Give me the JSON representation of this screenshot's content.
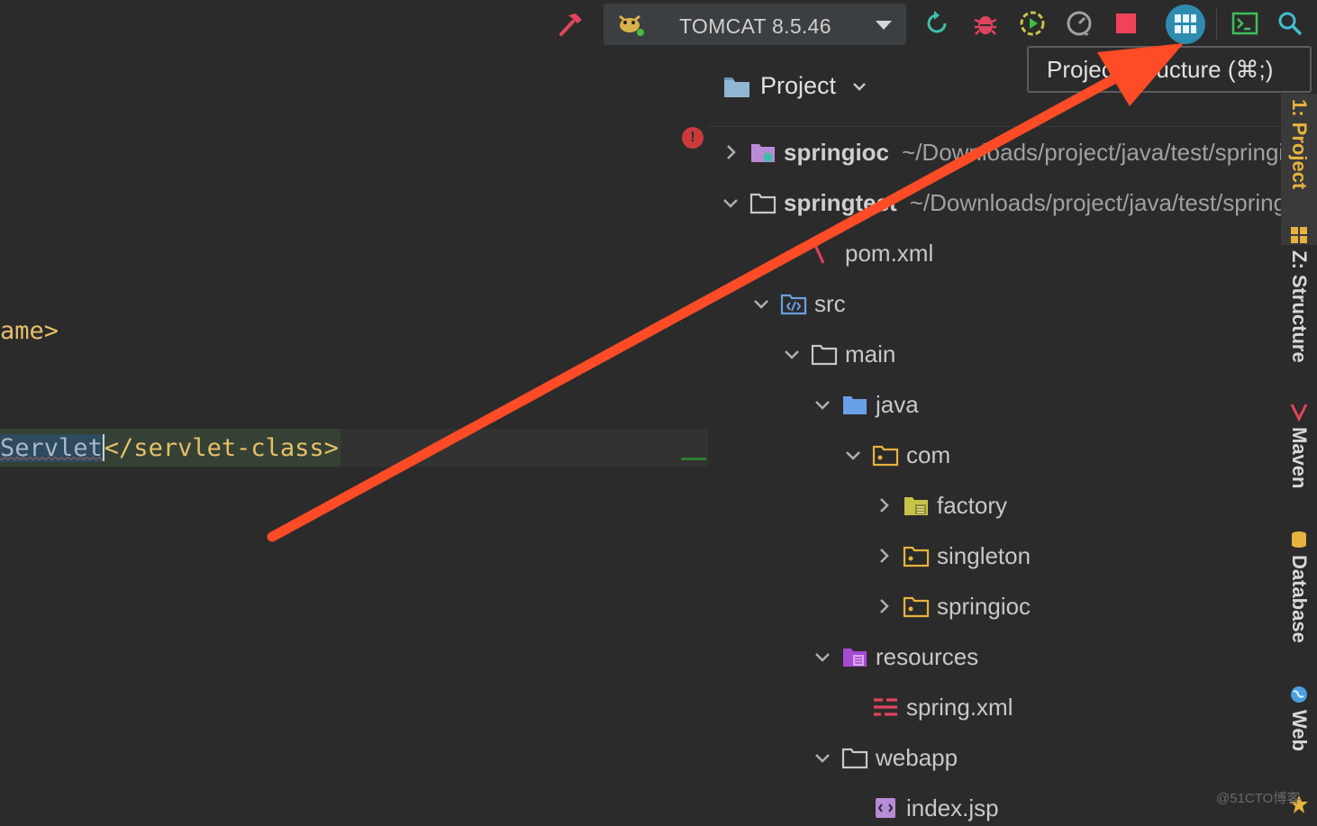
{
  "toolbar": {
    "run_config": "TOMCAT 8.5.46",
    "icons": [
      "build-hammer",
      "tomcat",
      "dropdown",
      "update",
      "debug",
      "run-coverage",
      "profile",
      "stop",
      "project-structure",
      "terminal",
      "search"
    ]
  },
  "tooltip": {
    "text": "Project Structure (⌘;)"
  },
  "editor": {
    "line1": "ame>",
    "line2_selected": "Servlet",
    "line2_rest": "</servlet-class>"
  },
  "project": {
    "title": "Project",
    "tree": [
      {
        "name": "springioc",
        "path": "~/Downloads/project/java/test/springioc",
        "bold": true,
        "expanded": false,
        "depth": 0,
        "icon": "module-folder"
      },
      {
        "name": "springtest",
        "path": "~/Downloads/project/java/test/springtest",
        "bold": true,
        "expanded": true,
        "depth": 0,
        "icon": "folder"
      },
      {
        "name": "pom.xml",
        "depth": 2,
        "icon": "maven-file"
      },
      {
        "name": "src",
        "depth": 1,
        "expanded": true,
        "icon": "source-folder"
      },
      {
        "name": "main",
        "depth": 2,
        "expanded": true,
        "icon": "folder"
      },
      {
        "name": "java",
        "depth": 3,
        "expanded": true,
        "icon": "blue-folder"
      },
      {
        "name": "com",
        "depth": 4,
        "expanded": true,
        "icon": "package-folder"
      },
      {
        "name": "factory",
        "depth": 5,
        "expanded": false,
        "icon": "factory-folder"
      },
      {
        "name": "singleton",
        "depth": 5,
        "expanded": false,
        "icon": "package-folder"
      },
      {
        "name": "springioc",
        "depth": 5,
        "expanded": false,
        "icon": "package-folder"
      },
      {
        "name": "resources",
        "depth": 3,
        "expanded": true,
        "icon": "resources-folder"
      },
      {
        "name": "spring.xml",
        "depth": 4,
        "icon": "spring-xml"
      },
      {
        "name": "webapp",
        "depth": 3,
        "expanded": true,
        "icon": "folder"
      },
      {
        "name": "index.jsp",
        "depth": 4,
        "icon": "jsp-file"
      }
    ]
  },
  "side_tabs": [
    {
      "label": "1: Project",
      "color": "#e7b33e"
    },
    {
      "label": "Z: Structure",
      "color": "#d8d8d8"
    },
    {
      "label": "Maven",
      "color": "#d8d8d8"
    },
    {
      "label": "Database",
      "color": "#d8d8d8"
    },
    {
      "label": "Web",
      "color": "#d8d8d8"
    }
  ],
  "watermark": "@51CTO博客",
  "colors": {
    "background": "#2b2b2b",
    "accent_orange": "#ff4b26",
    "tag_yellow": "#e8bf6a",
    "selection": "#2d4a5f",
    "error": "#c93b3b"
  }
}
